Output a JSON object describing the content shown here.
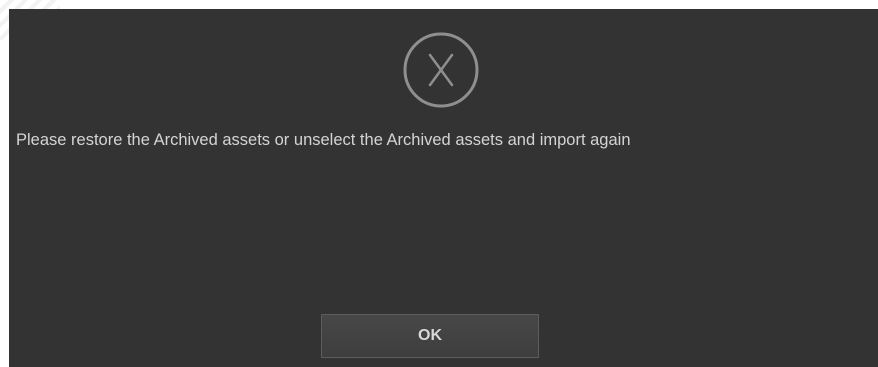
{
  "dialog": {
    "icon": "error-x-circle-icon",
    "message": "Please restore the Archived assets or unselect the Archived assets and import again",
    "ok_label": "OK"
  },
  "colors": {
    "background": "#333333",
    "text": "#d4d4d4",
    "icon": "#8f8f8f",
    "button": "#434343"
  }
}
